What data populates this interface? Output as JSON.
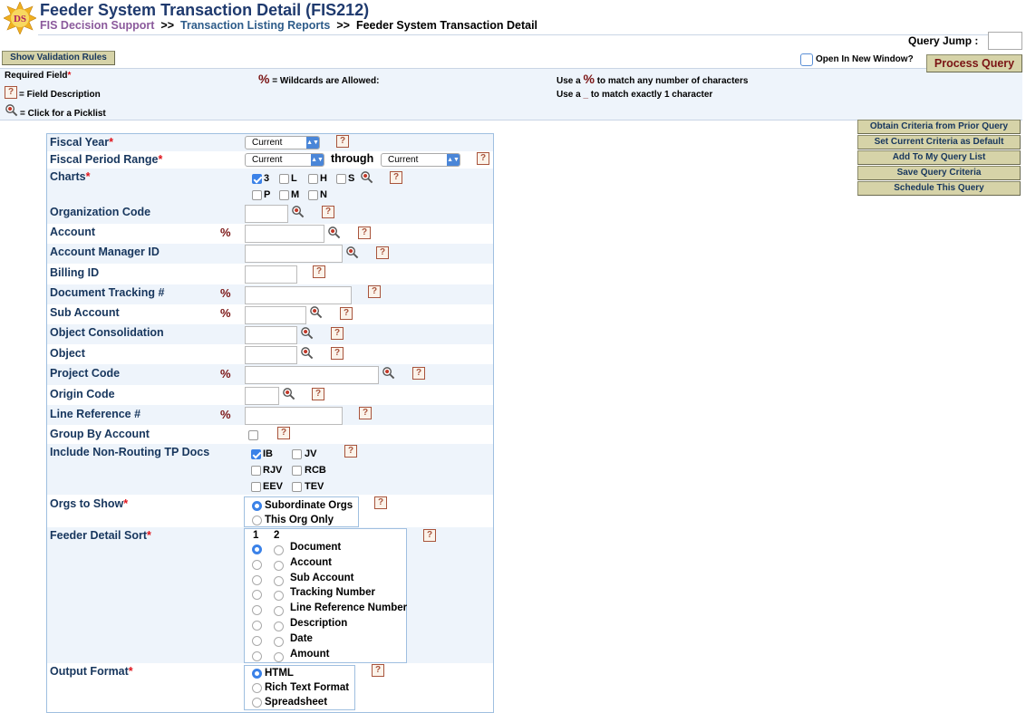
{
  "header": {
    "logo_text": "DS",
    "title": "Feeder System Transaction Detail (FIS212)",
    "crumb1": "FIS Decision Support",
    "sep1": ">>",
    "crumb2": "Transaction Listing Reports",
    "sep2": ">>",
    "crumb3": "Feeder System Transaction Detail"
  },
  "toolbar": {
    "query_jump_label": "Query Jump :",
    "show_validation": "Show Validation Rules",
    "open_new_window": "Open In New Window?",
    "process_query": "Process Query"
  },
  "legend": {
    "required": "Required Field",
    "field_desc": "= Field Description",
    "picklist": "= Click for a Picklist",
    "wildcard_sym": "%",
    "wildcard": "= Wildcards are Allowed:",
    "use1_a": "Use a",
    "use1_sym": "%",
    "use1_b": "to match any number of characters",
    "use2_a": "Use a",
    "use2_sym": "_",
    "use2_b": "to match exactly 1 character"
  },
  "side_buttons": [
    "Obtain Criteria from Prior Query",
    "Set Current Criteria as Default",
    "Add To My Query List",
    "Save Query Criteria",
    "Schedule This Query"
  ],
  "form": {
    "fiscal_year": {
      "label": "Fiscal Year",
      "value": "Current"
    },
    "fiscal_period": {
      "label": "Fiscal Period Range",
      "from": "Current",
      "through": "through",
      "to": "Current"
    },
    "charts": {
      "label": "Charts",
      "items": [
        {
          "l": "3",
          "on": true
        },
        {
          "l": "L",
          "on": false
        },
        {
          "l": "H",
          "on": false
        },
        {
          "l": "S",
          "on": false
        },
        {
          "l": "P",
          "on": false
        },
        {
          "l": "M",
          "on": false
        },
        {
          "l": "N",
          "on": false
        }
      ]
    },
    "org_code": {
      "label": "Organization Code"
    },
    "account": {
      "label": "Account",
      "pct": "%"
    },
    "acct_mgr": {
      "label": "Account Manager ID"
    },
    "billing": {
      "label": "Billing ID"
    },
    "doc_track": {
      "label": "Document Tracking #",
      "pct": "%"
    },
    "sub_account": {
      "label": "Sub Account",
      "pct": "%"
    },
    "obj_consol": {
      "label": "Object Consolidation"
    },
    "object": {
      "label": "Object"
    },
    "project": {
      "label": "Project Code",
      "pct": "%"
    },
    "origin": {
      "label": "Origin Code"
    },
    "line_ref": {
      "label": "Line Reference #",
      "pct": "%"
    },
    "group_by": {
      "label": "Group By Account"
    },
    "non_routing": {
      "label": "Include Non-Routing TP Docs",
      "items": [
        {
          "l": "IB",
          "on": true
        },
        {
          "l": "JV",
          "on": false
        },
        {
          "l": "RJV",
          "on": false
        },
        {
          "l": "RCB",
          "on": false
        },
        {
          "l": "EEV",
          "on": false
        },
        {
          "l": "TEV",
          "on": false
        }
      ]
    },
    "orgs_show": {
      "label": "Orgs to Show",
      "options": [
        "Subordinate Orgs",
        "This Org Only"
      ],
      "selected": 0
    },
    "sort": {
      "label": "Feeder Detail Sort",
      "col1": "1",
      "col2": "2",
      "options": [
        "Document",
        "Account",
        "Sub Account",
        "Tracking Number",
        "Line Reference Number",
        "Description",
        "Date",
        "Amount"
      ],
      "selected_col1": 0
    },
    "output": {
      "label": "Output Format",
      "options": [
        "HTML",
        "Rich Text Format",
        "Spreadsheet"
      ],
      "selected": 0
    }
  },
  "colors": {
    "accent": "#3b82e8",
    "required": "#e0141b",
    "band": "#eef4fb",
    "button": "#d6d3a8"
  }
}
